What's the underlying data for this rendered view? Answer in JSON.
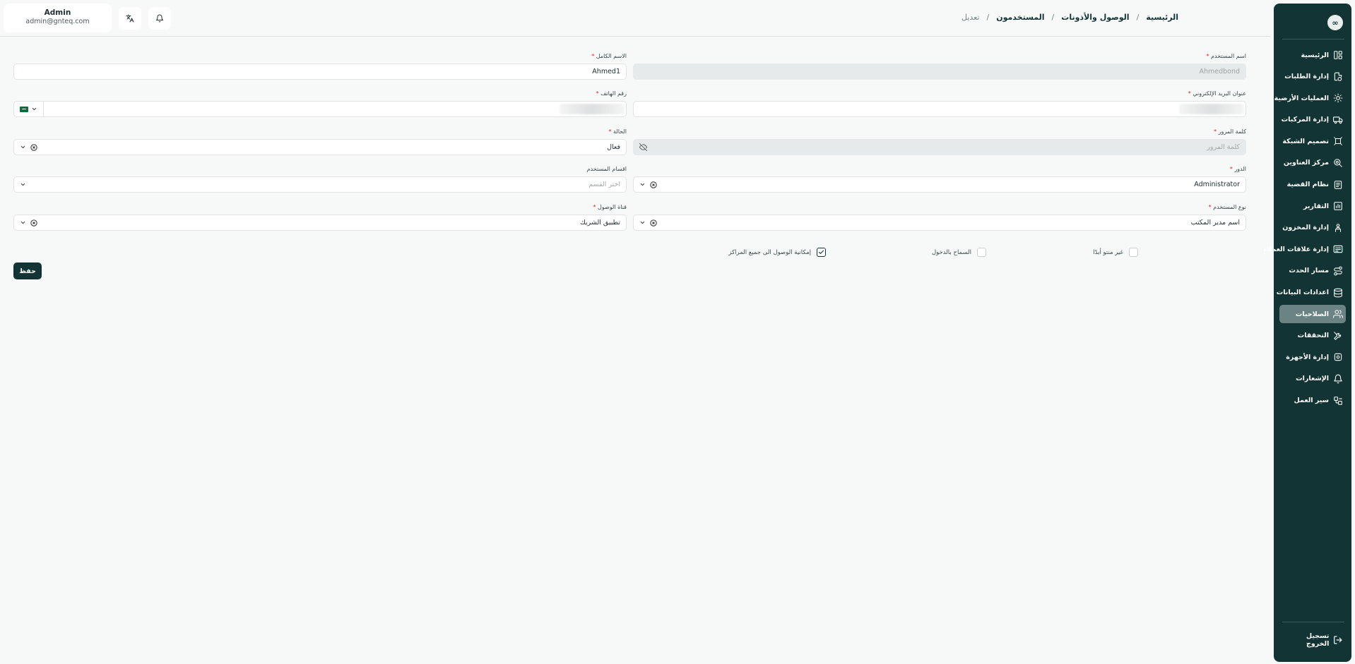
{
  "topbar": {
    "user_name": "Admin",
    "user_email": "admin@gnteq.com"
  },
  "breadcrumb": [
    "الرئيسية",
    "الوصول والأذونات",
    "المستخدمون",
    "تعديل"
  ],
  "sidebar": {
    "logo_text": "∞",
    "items": [
      {
        "label": "الرئيسية",
        "icon": "layout-icon"
      },
      {
        "label": "إدارة الطلبات",
        "icon": "orders-icon"
      },
      {
        "label": "العمليات الأرضية",
        "icon": "sun-gear-icon"
      },
      {
        "label": "إدارة المركبات",
        "icon": "truck-icon"
      },
      {
        "label": "تصميم الشبكة",
        "icon": "network-icon"
      },
      {
        "label": "مركز العناوين",
        "icon": "map-pin-icon"
      },
      {
        "label": "نظام القضية",
        "icon": "case-icon"
      },
      {
        "label": "التقارير",
        "icon": "chart-icon"
      },
      {
        "label": "إدارة المخزون",
        "icon": "warehouse-icon"
      },
      {
        "label": "إدارة علاقات العملاء",
        "icon": "crm-icon"
      },
      {
        "label": "مسار الحدث",
        "icon": "route-icon"
      },
      {
        "label": "اعدادات البيانات",
        "icon": "database-icon"
      },
      {
        "label": "الصلاحيات",
        "icon": "users-icon"
      },
      {
        "label": "التحققات",
        "icon": "tools-icon"
      },
      {
        "label": "إدارة الأجهزة",
        "icon": "device-icon"
      },
      {
        "label": "الإشعارات",
        "icon": "bell-icon"
      },
      {
        "label": "سير العمل",
        "icon": "workflow-icon"
      }
    ],
    "active_index": 12,
    "logout_label": "تسجيل الخروج"
  },
  "form": {
    "username": {
      "label": "اسم المستخدم",
      "value": "Ahmedbond"
    },
    "full_name": {
      "label": "الاسم الكامل",
      "value": "Ahmed1"
    },
    "email": {
      "label": "عنوان البريد الإلكتروني"
    },
    "phone": {
      "label": "رقم الهاتف"
    },
    "password": {
      "label": "كلمة المرور",
      "placeholder": "كلمة المرور"
    },
    "status": {
      "label": "الحالة",
      "value": "فعال"
    },
    "role": {
      "label": "الدور",
      "value": "Administrator"
    },
    "departments": {
      "label": "اقسام المستخدم",
      "placeholder": "اختر القسم"
    },
    "user_type": {
      "label": "نوع المستخدم",
      "value": "اسم مدير المكتب"
    },
    "access_channel": {
      "label": "قناة الوصول",
      "value": "تطبيق الشريك"
    },
    "checkboxes": [
      {
        "label": "غير منتو أبدًا",
        "checked": false
      },
      {
        "label": "السماح بالدخول",
        "checked": false
      },
      {
        "label": "إمكانية الوصول الى جميع المراكز",
        "checked": true
      }
    ],
    "save_label": "حفظ"
  }
}
